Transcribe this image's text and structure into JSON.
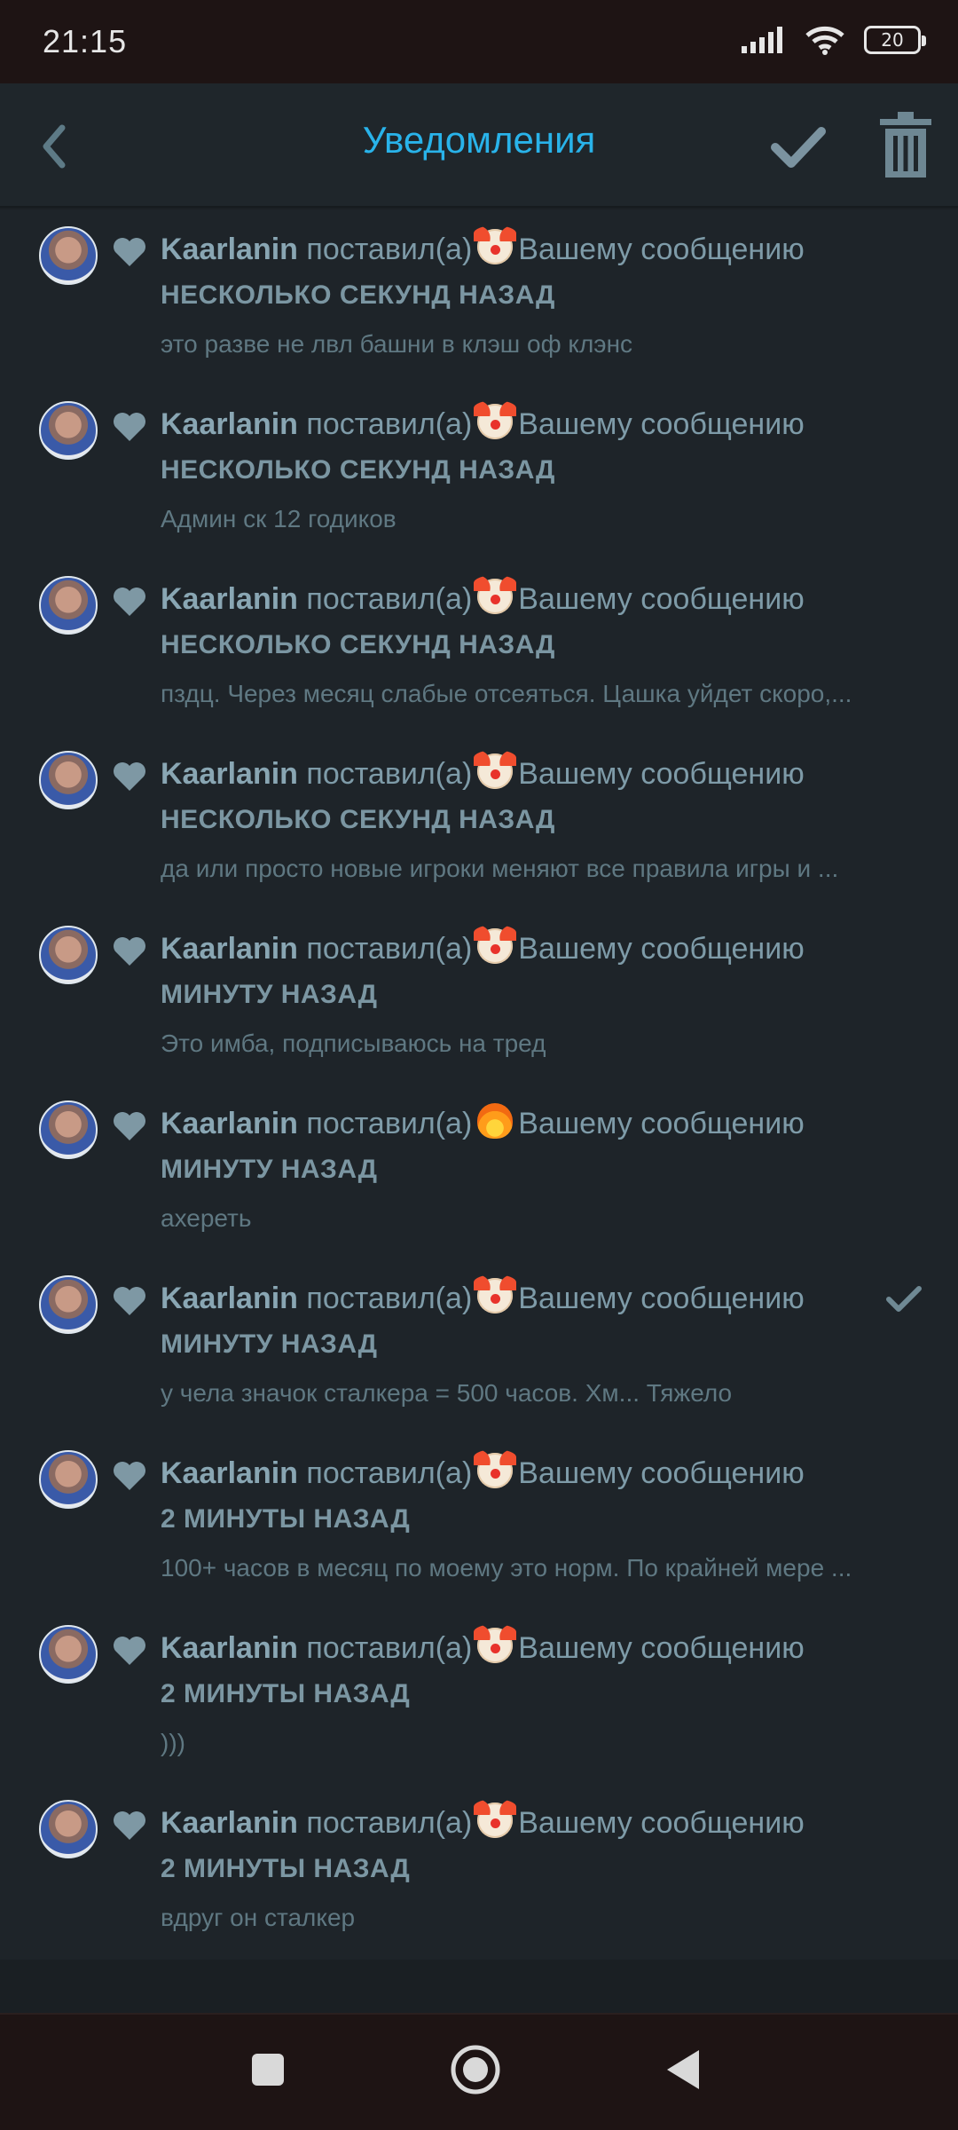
{
  "status_bar": {
    "time": "21:15",
    "battery": "20",
    "icons": [
      "signal-icon",
      "wifi-icon",
      "battery-icon"
    ]
  },
  "header": {
    "title": "Уведомления",
    "icons": [
      "back-arrow-icon",
      "checkmark-icon",
      "trash-icon"
    ],
    "title_color": "#29b3ea"
  },
  "notifications": [
    {
      "user": "Kaarlanin",
      "action": "поставил(а)",
      "reaction": "clown",
      "target": "Вашему сообщению",
      "time": "НЕСКОЛЬКО СЕКУНД НАЗАД",
      "message": "это разве не лвл башни в клэш оф клэнс",
      "read": false
    },
    {
      "user": "Kaarlanin",
      "action": "поставил(а)",
      "reaction": "clown",
      "target": "Вашему сообщению",
      "time": "НЕСКОЛЬКО СЕКУНД НАЗАД",
      "message": "Админ ск 12 годиков",
      "read": false
    },
    {
      "user": "Kaarlanin",
      "action": "поставил(а)",
      "reaction": "clown",
      "target": "Вашему сообщению",
      "time": "НЕСКОЛЬКО СЕКУНД НАЗАД",
      "message": "пздц. Через месяц слабые отсеяться. Цашка уйдет скоро,...",
      "read": false
    },
    {
      "user": "Kaarlanin",
      "action": "поставил(а)",
      "reaction": "clown",
      "target": "Вашему сообщению",
      "time": "НЕСКОЛЬКО СЕКУНД НАЗАД",
      "message": "да или просто новые игроки меняют все правила игры и ...",
      "read": false
    },
    {
      "user": "Kaarlanin",
      "action": "поставил(а)",
      "reaction": "clown",
      "target": "Вашему сообщению",
      "time": "МИНУТУ НАЗАД",
      "message": "Это имба, подписываюсь на тред",
      "read": false
    },
    {
      "user": "Kaarlanin",
      "action": "поставил(а)",
      "reaction": "fire",
      "target": "Вашему сообщению",
      "time": "МИНУТУ НАЗАД",
      "message": "ахереть",
      "read": false
    },
    {
      "user": "Kaarlanin",
      "action": "поставил(а)",
      "reaction": "clown",
      "target": "Вашему сообщению",
      "time": "МИНУТУ НАЗАД",
      "message": "у чела значок сталкера = 500 часов. Хм... Тяжело",
      "read": true
    },
    {
      "user": "Kaarlanin",
      "action": "поставил(а)",
      "reaction": "clown",
      "target": "Вашему сообщению",
      "time": "2 МИНУТЫ НАЗАД",
      "message": "100+ часов в месяц по моему это норм. По крайней мере ...",
      "read": false
    },
    {
      "user": "Kaarlanin",
      "action": "поставил(а)",
      "reaction": "clown",
      "target": "Вашему сообщению",
      "time": "2 МИНУТЫ НАЗАД",
      "message": ")))",
      "read": false
    },
    {
      "user": "Kaarlanin",
      "action": "поставил(а)",
      "reaction": "clown",
      "target": "Вашему сообщению",
      "time": "2 МИНУТЫ НАЗАД",
      "message": "вдруг он сталкер",
      "read": false
    }
  ],
  "nav_bar": {
    "icons": [
      "recents-square-icon",
      "home-circle-icon",
      "back-triangle-icon"
    ]
  }
}
